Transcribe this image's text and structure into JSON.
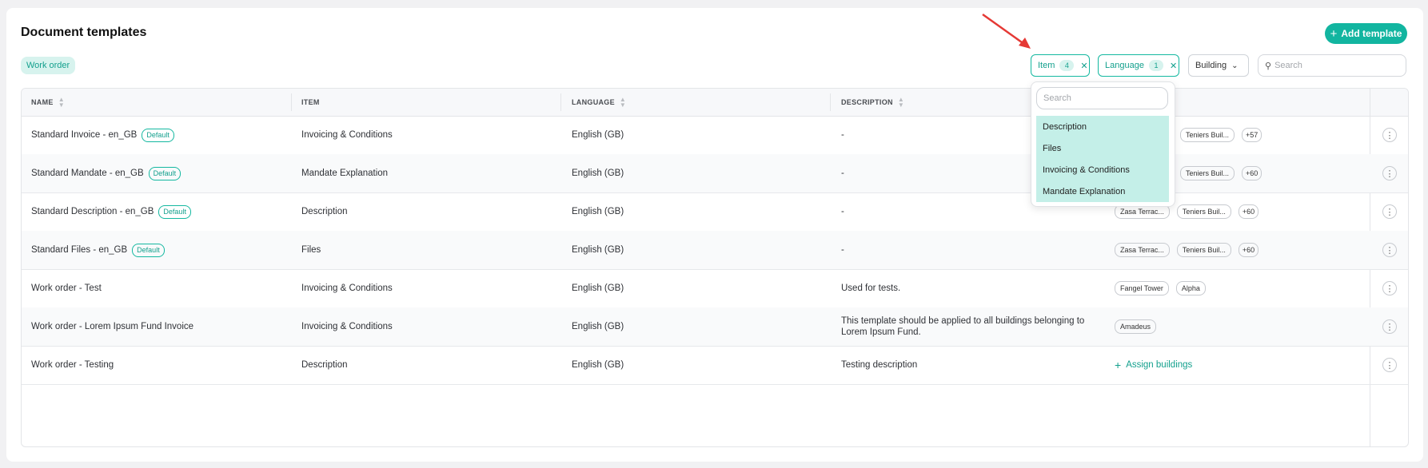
{
  "page": {
    "title": "Document templates",
    "add_button": "Add template",
    "active_chip": "Work order"
  },
  "filters": {
    "item": {
      "label": "Item",
      "count": "4"
    },
    "language": {
      "label": "Language",
      "count": "1"
    },
    "building": {
      "label": "Building"
    },
    "search_placeholder": "Search"
  },
  "dropdown": {
    "search_placeholder": "Search",
    "options": [
      "Description",
      "Files",
      "Invoicing & Conditions",
      "Mandate Explanation"
    ]
  },
  "table": {
    "headers": {
      "name": "NAME",
      "item": "ITEM",
      "language": "LANGUAGE",
      "description": "DESCRIPTION"
    },
    "default_badge": "Default",
    "assign_label": "Assign buildings",
    "rows": [
      {
        "name": "Standard Invoice - en_GB",
        "item": "Invoicing & Conditions",
        "language": "English (GB)",
        "description": "-",
        "buildings": [
          "Teniers Buil..."
        ],
        "more": "+57",
        "is_default": true
      },
      {
        "name": "Standard Mandate - en_GB",
        "item": "Mandate Explanation",
        "language": "English (GB)",
        "description": "-",
        "buildings": [
          "Teniers Buil..."
        ],
        "more": "+60",
        "is_default": true
      },
      {
        "name": "Standard Description - en_GB",
        "item": "Description",
        "language": "English (GB)",
        "description": "-",
        "buildings": [
          "Zasa Terrac...",
          "Teniers Buil..."
        ],
        "more": "+60",
        "is_default": true
      },
      {
        "name": "Standard Files - en_GB",
        "item": "Files",
        "language": "English (GB)",
        "description": "-",
        "buildings": [
          "Zasa Terrac...",
          "Teniers Buil..."
        ],
        "more": "+60",
        "is_default": true
      },
      {
        "name": "Work order - Test",
        "item": "Invoicing & Conditions",
        "language": "English (GB)",
        "description": "Used for tests.",
        "buildings": [
          "Fangel Tower",
          "Alpha"
        ],
        "more": "",
        "is_default": false
      },
      {
        "name": "Work order - Lorem Ipsum Fund Invoice",
        "item": "Invoicing & Conditions",
        "language": "English (GB)",
        "description": "This template should be applied to all buildings belonging to Lorem Ipsum Fund.",
        "buildings": [
          "Amadeus"
        ],
        "more": "",
        "is_default": false
      },
      {
        "name": "Work order - Testing",
        "item": "Description",
        "language": "English (GB)",
        "description": "Testing description",
        "buildings": [],
        "more": "",
        "is_default": false
      }
    ]
  },
  "colors": {
    "accent": "#12b5a0",
    "accent_light": "#c4efe8",
    "annotation_arrow": "#e53935"
  }
}
